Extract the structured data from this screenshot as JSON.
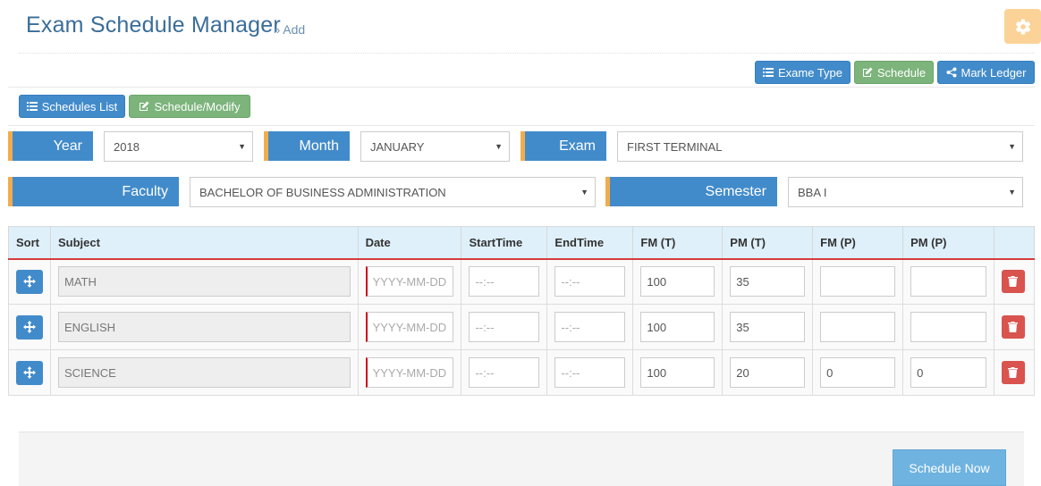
{
  "header": {
    "title": "Exam Schedule Manager",
    "subtitle_chevron": "»",
    "subtitle": "Add"
  },
  "toolbar_top": {
    "exam_type_label": "Exame Type",
    "schedule_label": "Schedule",
    "mark_ledger_label": "Mark Ledger"
  },
  "toolbar_tabs": {
    "schedules_list_label": "Schedules List",
    "schedule_modify_label": "Schedule/Modify"
  },
  "filters": {
    "year_label": "Year",
    "year_value": "2018",
    "month_label": "Month",
    "month_value": "JANUARY",
    "exam_label": "Exam",
    "exam_value": "FIRST TERMINAL",
    "faculty_label": "Faculty",
    "faculty_value": "BACHELOR OF BUSINESS ADMINISTRATION",
    "semester_label": "Semester",
    "semester_value": "BBA I"
  },
  "table": {
    "headers": [
      "Sort",
      "Subject",
      "Date",
      "StartTime",
      "EndTime",
      "FM (T)",
      "PM (T)",
      "FM (P)",
      "PM (P)",
      ""
    ],
    "date_placeholder": "YYYY-MM-DD",
    "time_placeholder": "--:--",
    "rows": [
      {
        "subject": "MATH",
        "fm_t": "100",
        "pm_t": "35",
        "fm_p": "",
        "pm_p": ""
      },
      {
        "subject": "ENGLISH",
        "fm_t": "100",
        "pm_t": "35",
        "fm_p": "",
        "pm_p": ""
      },
      {
        "subject": "SCIENCE",
        "fm_t": "100",
        "pm_t": "20",
        "fm_p": "0",
        "pm_p": "0"
      }
    ]
  },
  "footer": {
    "submit_label": "Schedule Now"
  },
  "colors": {
    "primary": "#428bca",
    "success": "#7cb47c",
    "danger": "#d9534f",
    "accent": "#f0ad4e",
    "title": "#3a6d99"
  },
  "icons": {
    "settings": "gear-icon",
    "list": "list-icon",
    "edit": "edit-icon",
    "share": "share-icon",
    "move": "move-icon",
    "delete": "trash-icon",
    "dropdown": "caret-down-icon"
  }
}
